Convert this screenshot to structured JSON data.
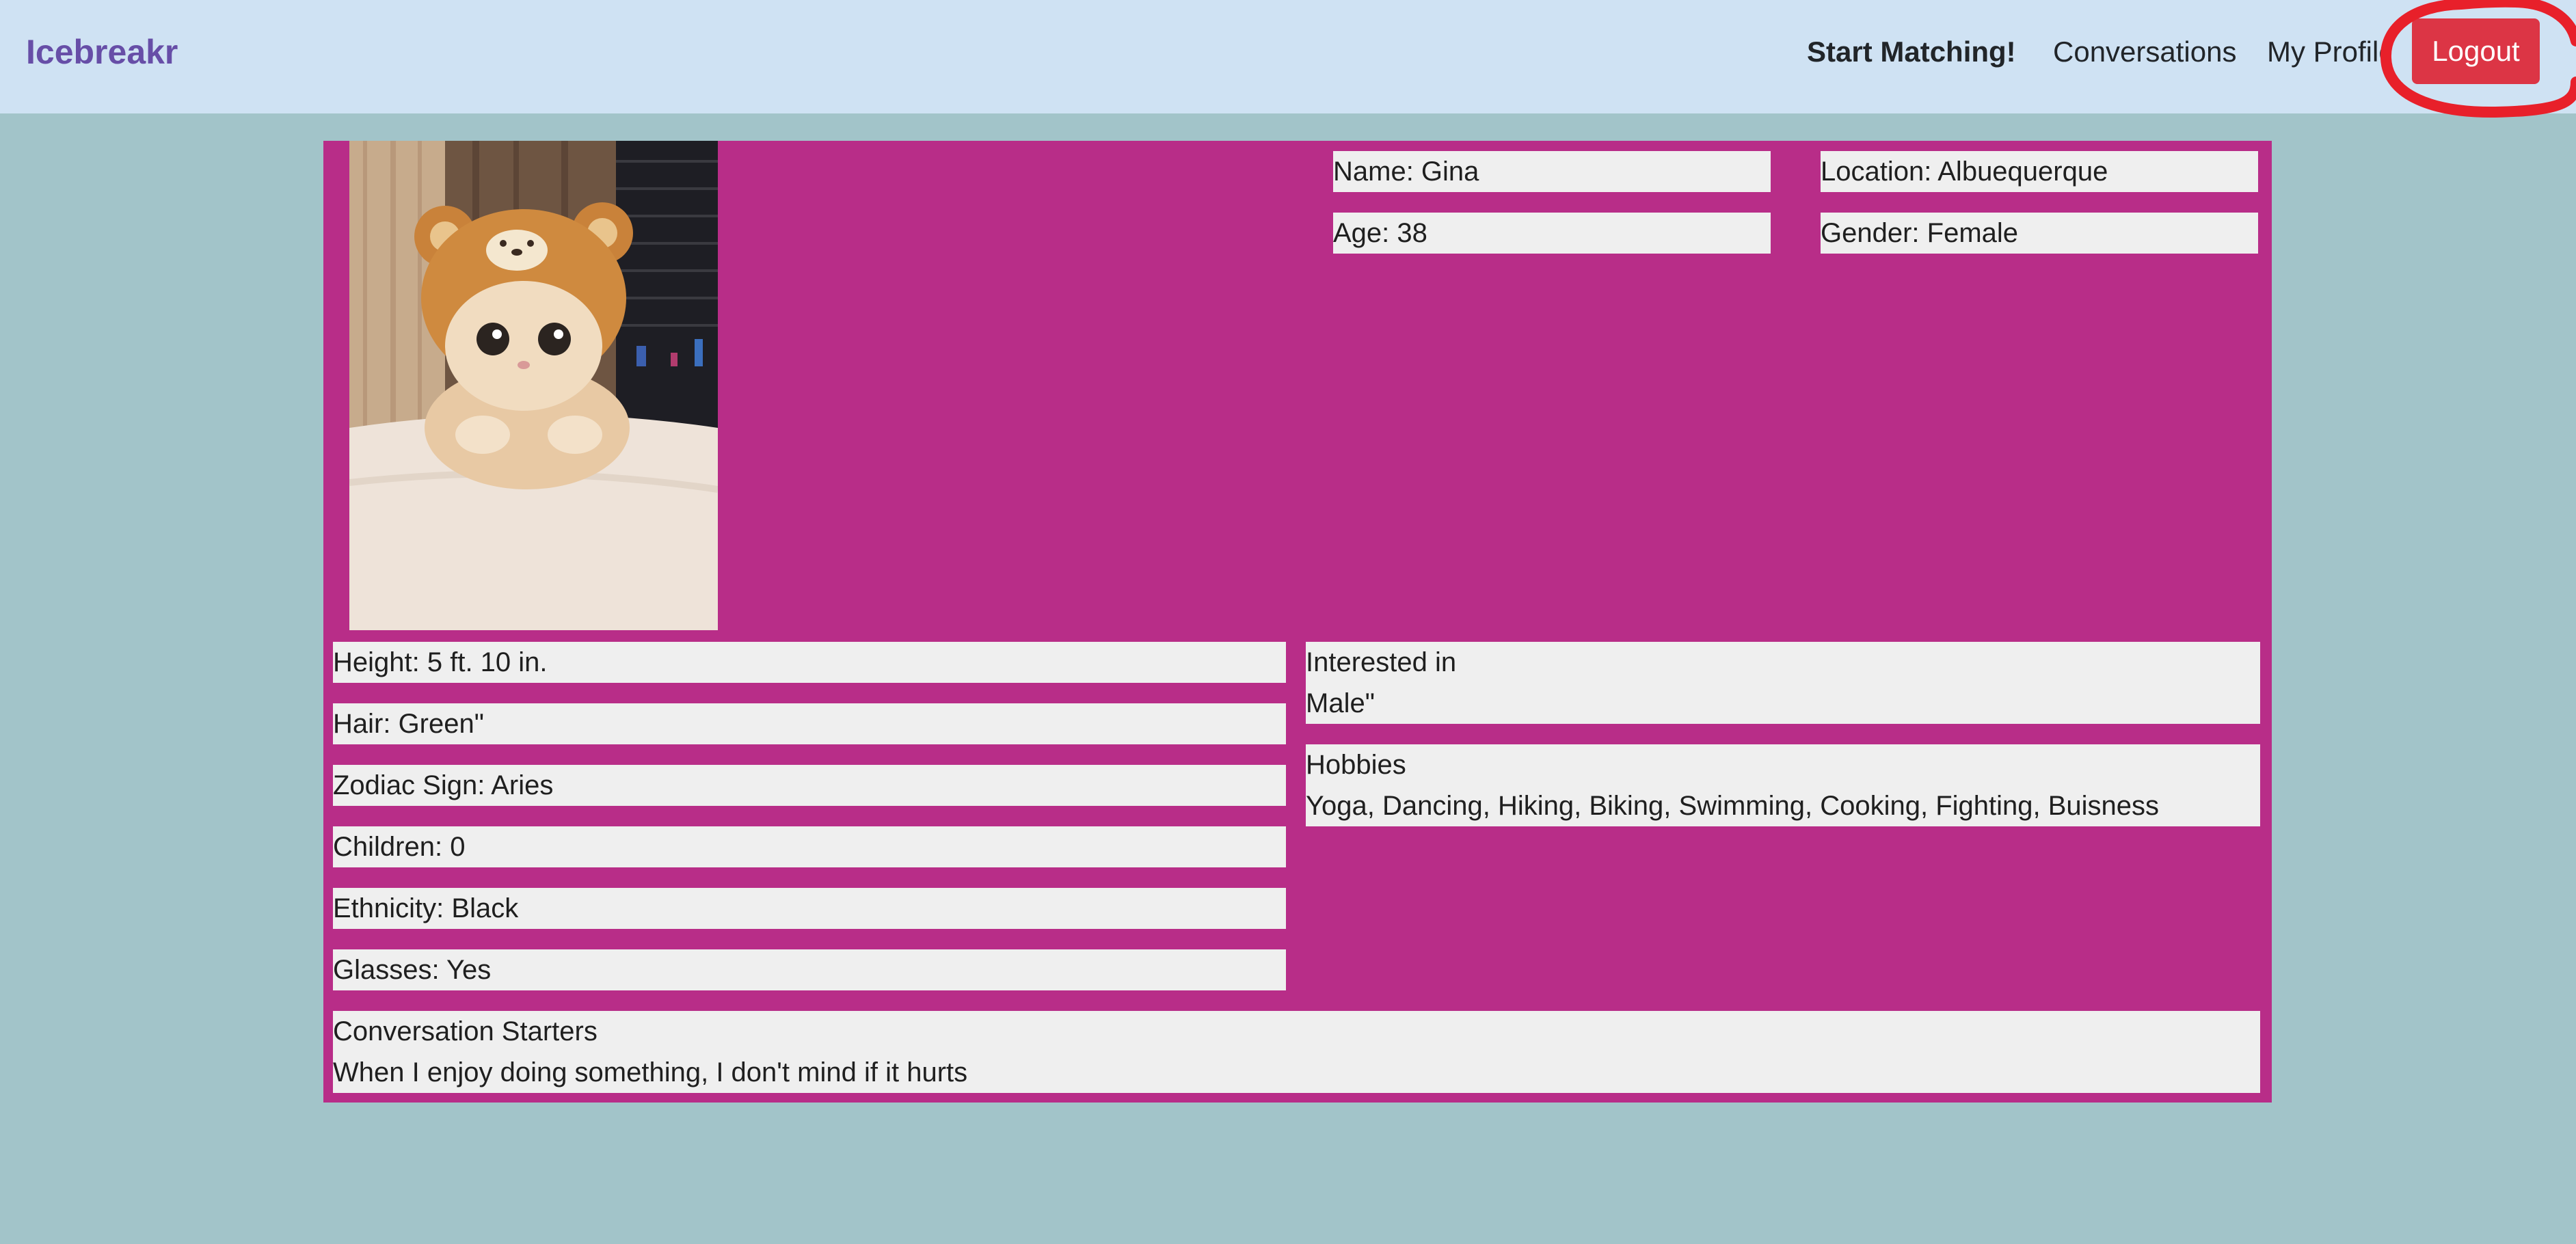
{
  "navbar": {
    "brand": "Icebreakr",
    "links": {
      "start_matching": "Start Matching!",
      "conversations": "Conversations",
      "my_profile": "My Profile"
    },
    "logout_label": "Logout"
  },
  "colors": {
    "navbar_bg": "#cfe2f3",
    "page_bg": "#a2c4c9",
    "card_bg": "#b82d88",
    "field_bg": "#efefef",
    "brand": "#674ea7",
    "logout_bg": "#dc3545",
    "annotation": "#e8202a"
  },
  "profile": {
    "photo_icon": "cat-photo",
    "name": "Name: Gina",
    "location": "Location: Albuequerque",
    "age": "Age: 38",
    "gender": "Gender: Female",
    "height": "Height: 5 ft. 10 in.",
    "hair": "Hair: Green\"",
    "zodiac": "Zodiac Sign: Aries",
    "children": "Children: 0",
    "ethnicity": "Ethnicity: Black",
    "glasses": "Glasses: Yes",
    "interested_in": {
      "label": "Interested in",
      "value": "Male\""
    },
    "hobbies": {
      "label": "Hobbies",
      "value": "Yoga, Dancing, Hiking, Biking, Swimming, Cooking, Fighting, Buisness"
    },
    "conversation_starters": {
      "label": "Conversation Starters",
      "value": "When I enjoy doing something, I don't mind if it hurts"
    }
  }
}
